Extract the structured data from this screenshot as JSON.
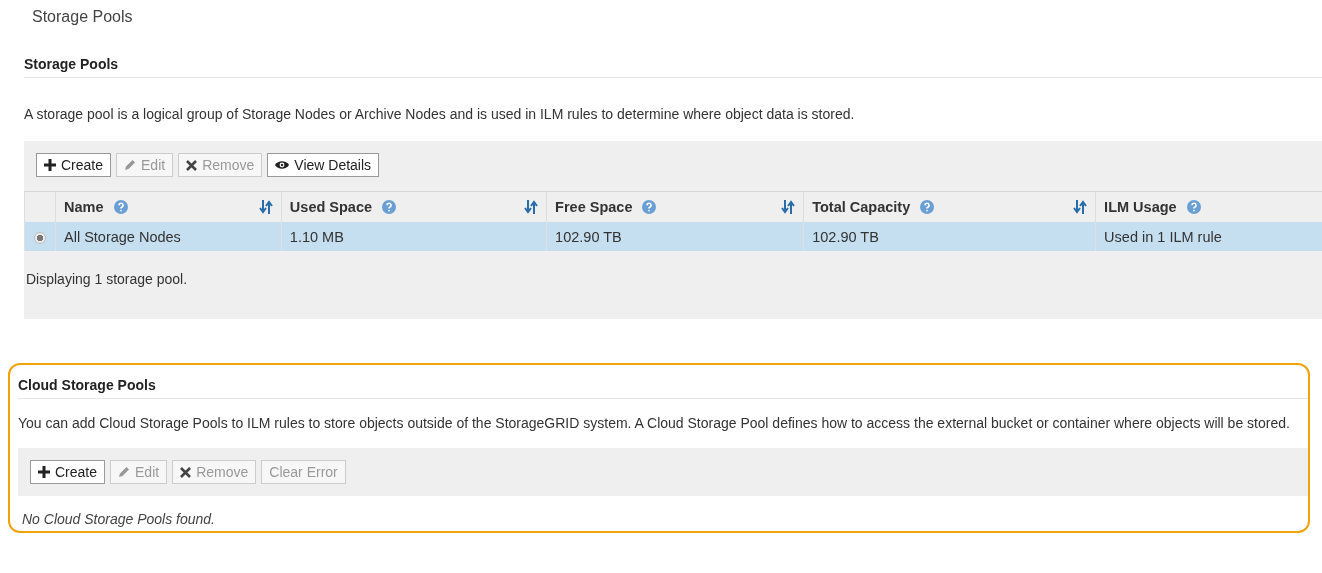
{
  "page_title": "Storage Pools",
  "storage_pools": {
    "heading": "Storage Pools",
    "description": "A storage pool is a logical group of Storage Nodes or Archive Nodes and is used in ILM rules to determine where object data is stored.",
    "toolbar": [
      {
        "kind": "create",
        "label": "Create",
        "disabled": false
      },
      {
        "kind": "edit",
        "label": "Edit",
        "disabled": true
      },
      {
        "kind": "remove",
        "label": "Remove",
        "disabled": true
      },
      {
        "kind": "view",
        "label": "View Details",
        "disabled": false
      }
    ],
    "table": {
      "columns": [
        {
          "label": "Name",
          "sortable": true
        },
        {
          "label": "Used Space",
          "sortable": true
        },
        {
          "label": "Free Space",
          "sortable": true
        },
        {
          "label": "Total Capacity",
          "sortable": true
        },
        {
          "label": "ILM Usage",
          "sortable": false
        }
      ],
      "rows": [
        {
          "selected": true,
          "cells": [
            "All Storage Nodes",
            "1.10 MB",
            "102.90 TB",
            "102.90 TB",
            "Used in 1 ILM rule"
          ]
        }
      ]
    },
    "footer": "Displaying 1 storage pool."
  },
  "cloud_storage_pools": {
    "highlighted": true,
    "heading": "Cloud Storage Pools",
    "description": "You can add Cloud Storage Pools to ILM rules to store objects outside of the StorageGRID system. A Cloud Storage Pool defines how to access the external bucket or container where objects will be stored.",
    "toolbar": [
      {
        "kind": "create",
        "label": "Create",
        "disabled": false
      },
      {
        "kind": "edit",
        "label": "Edit",
        "disabled": true
      },
      {
        "kind": "remove",
        "label": "Remove",
        "disabled": true
      },
      {
        "kind": "text",
        "label": "Clear Error",
        "disabled": true
      }
    ],
    "empty_message": "No Cloud Storage Pools found."
  }
}
